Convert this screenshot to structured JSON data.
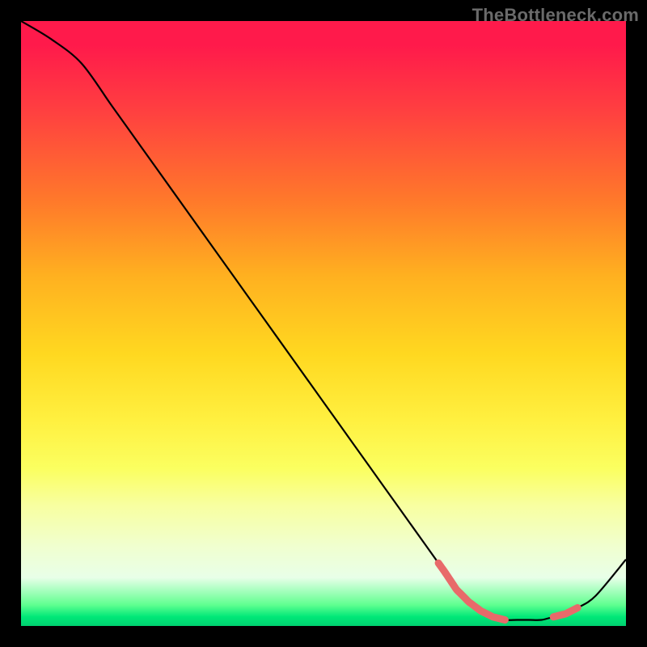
{
  "watermark": "TheBottleneck.com",
  "chart_data": {
    "type": "line",
    "title": "",
    "xlabel": "",
    "ylabel": "",
    "xlim": [
      0,
      100
    ],
    "ylim": [
      0,
      100
    ],
    "x": [
      0,
      5,
      10,
      15,
      20,
      25,
      30,
      35,
      40,
      45,
      50,
      55,
      60,
      65,
      70,
      72,
      74,
      76,
      78,
      80,
      82,
      84,
      86,
      88,
      90,
      92,
      95,
      100
    ],
    "values": [
      100,
      97,
      93,
      86,
      79,
      72,
      65,
      58,
      51,
      44,
      37,
      30,
      23,
      16,
      9,
      6,
      4,
      2.5,
      1.5,
      1,
      1,
      1,
      1,
      1.5,
      2,
      3,
      5,
      11
    ],
    "highlight_x_ranges": [
      [
        69,
        80
      ],
      [
        88,
        92
      ]
    ],
    "colors": {
      "line": "#000000",
      "highlight": "#e86a6a"
    }
  }
}
